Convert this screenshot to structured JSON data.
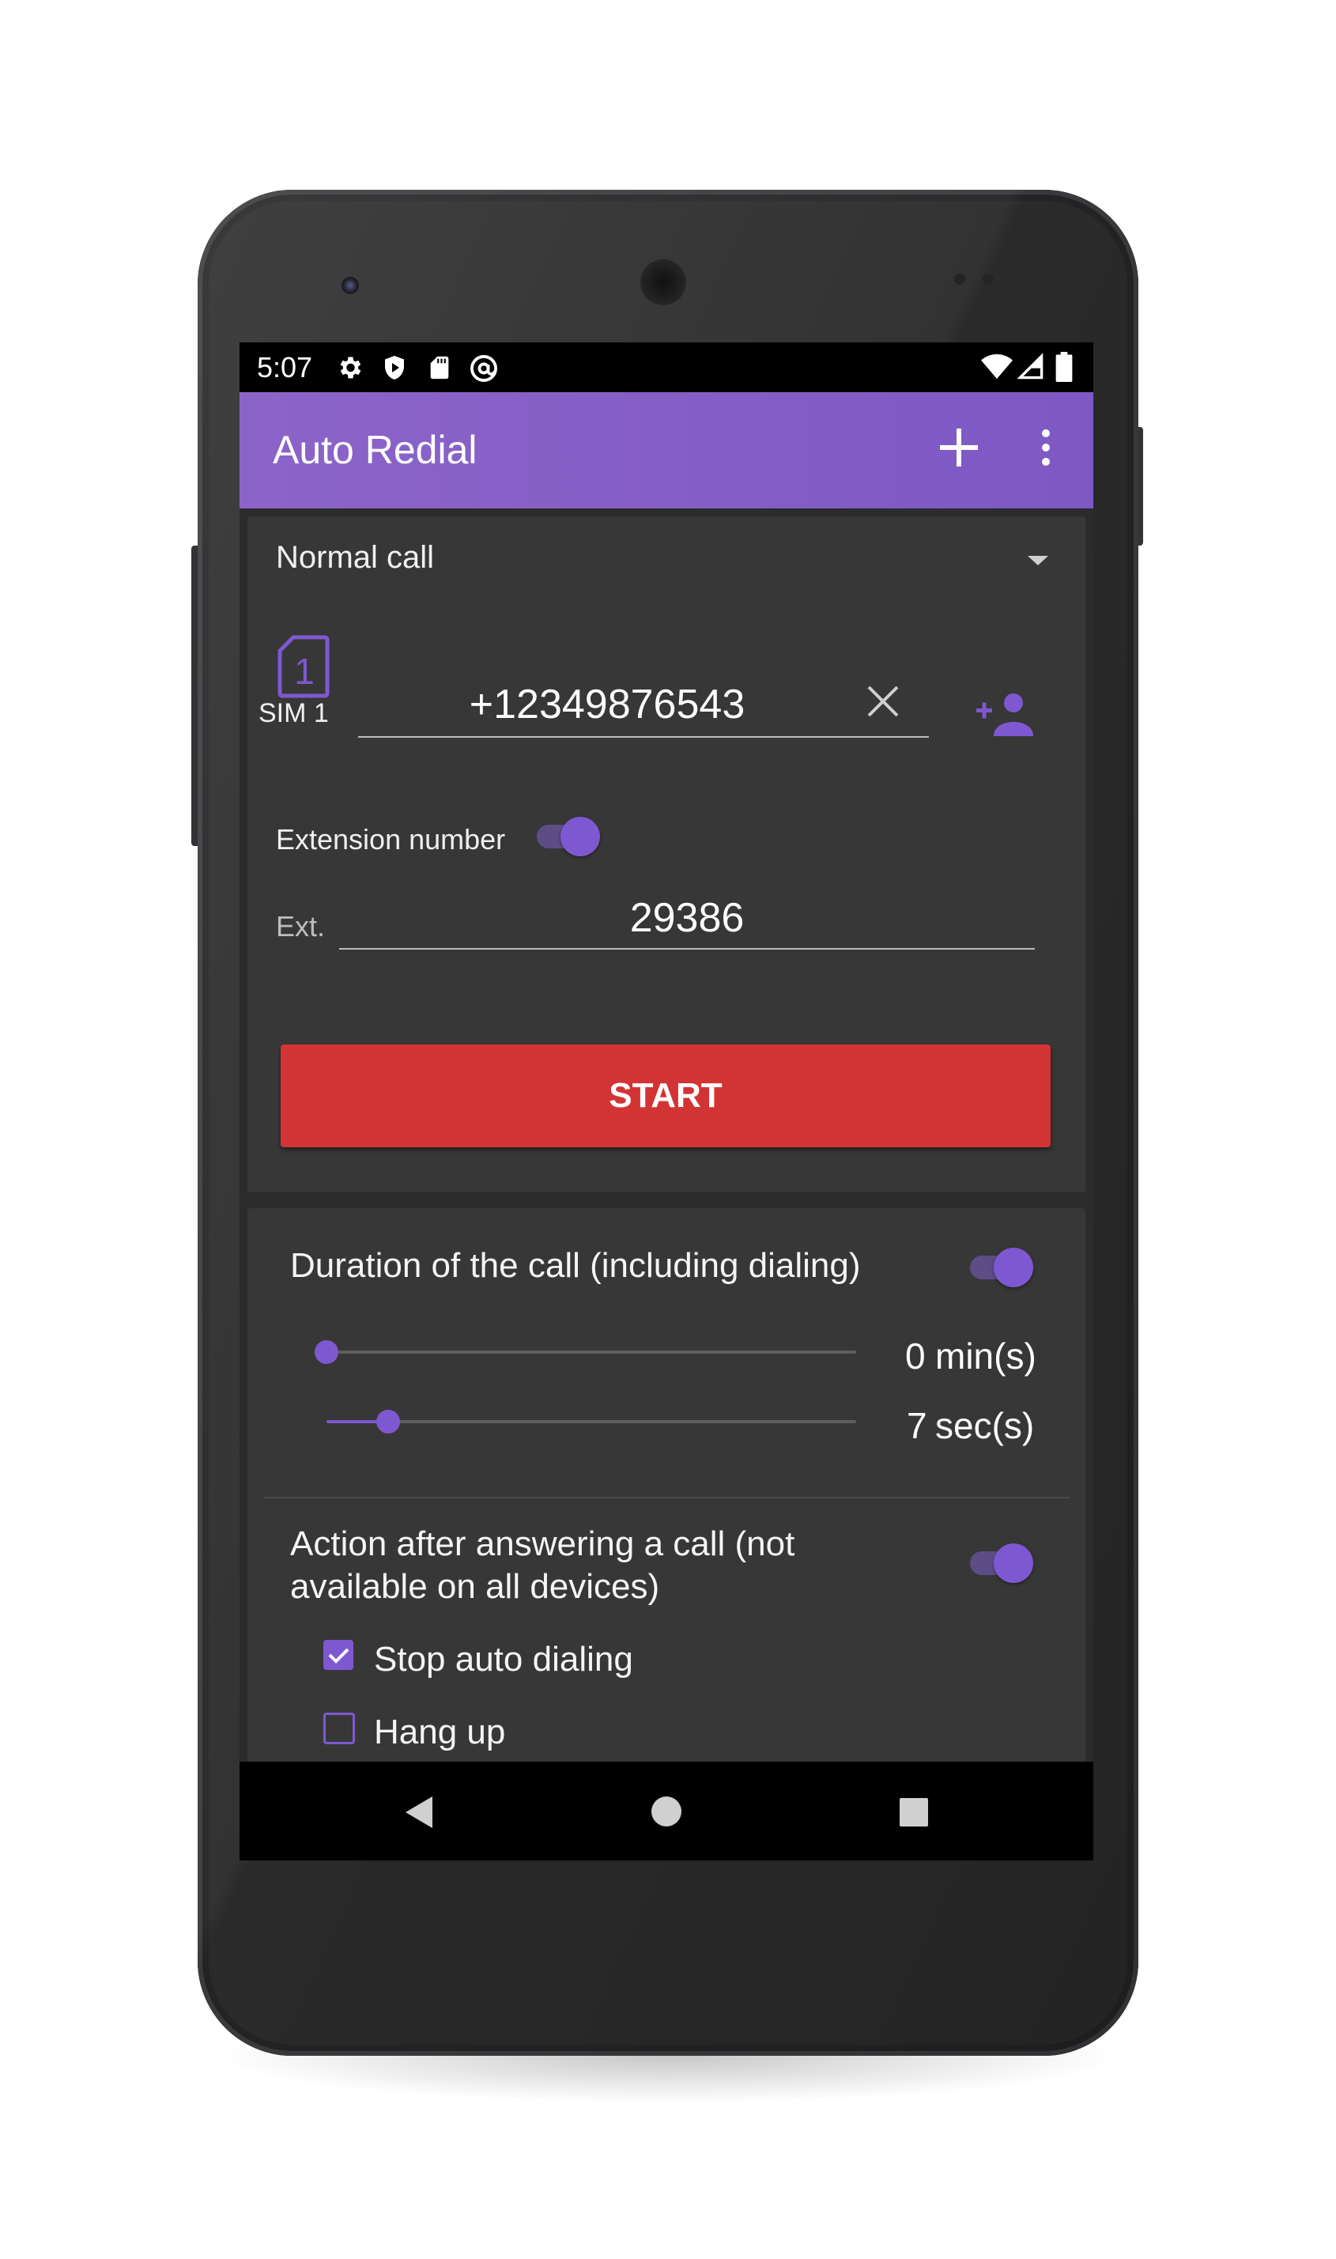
{
  "status_bar": {
    "time": "5:07",
    "left_icons": [
      "gear-icon",
      "shield-icon",
      "sd-card-icon",
      "at-sign-icon"
    ],
    "right_icons": [
      "wifi-icon",
      "signal-icon",
      "battery-icon"
    ]
  },
  "app_bar": {
    "title": "Auto Redial",
    "actions": [
      "add-icon",
      "more-vert-icon"
    ]
  },
  "call_setup": {
    "call_type": "Normal call",
    "sim_label": "SIM 1",
    "sim_number": "1",
    "phone_number": "+12349876543",
    "extension_label": "Extension number",
    "extension_enabled": true,
    "ext_prefix": "Ext.",
    "ext_value": "29386",
    "start_label": "START"
  },
  "duration": {
    "label": "Duration of the call (including dialing)",
    "enabled": true,
    "minutes_value": "0",
    "minutes_unit": "min(s)",
    "minutes_fraction": 0.0,
    "seconds_value": "7",
    "seconds_unit": "sec(s)",
    "seconds_fraction": 0.12
  },
  "after_answer": {
    "label_line1": "Action after answering a call (not",
    "label_line2": "available on all devices)",
    "enabled": true,
    "options": [
      {
        "label": "Stop auto dialing",
        "checked": true
      },
      {
        "label": "Hang up",
        "checked": false
      }
    ]
  },
  "colors": {
    "accent": "#7e58d0",
    "app_bar": "#8460c6",
    "start_button": "#d23434",
    "background": "#2b2b2c"
  }
}
